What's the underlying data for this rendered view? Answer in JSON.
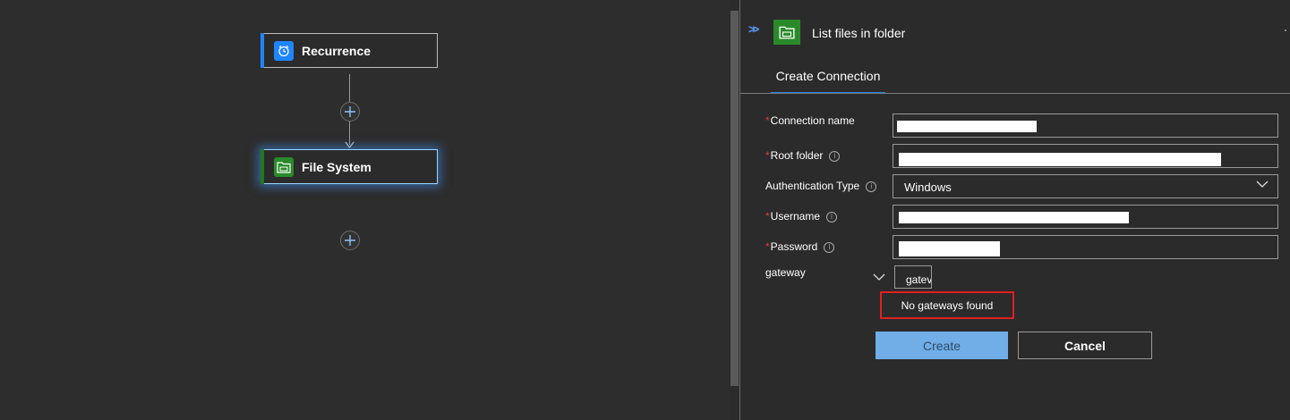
{
  "designer": {
    "nodes": [
      {
        "label": "Recurrence",
        "icon": "alarm-clock-icon",
        "accent": "#1f85ff"
      },
      {
        "label": "File System",
        "icon": "folder-icon",
        "accent": "#1f7a1f"
      }
    ]
  },
  "panel": {
    "title": "List files in folder",
    "title_icon": "folder-icon",
    "tab_label": "Create Connection",
    "fields": {
      "connection_name": {
        "label": "Connection name",
        "required": "*",
        "value": ""
      },
      "root_folder": {
        "label": "Root folder",
        "required": "*",
        "value": ""
      },
      "auth_type": {
        "label": "Authentication Type",
        "value": "Windows"
      },
      "username": {
        "label": "Username",
        "required": "*",
        "value": ""
      },
      "password": {
        "label": "Password",
        "required": "*",
        "value": ""
      },
      "gateway": {
        "label": "gateway",
        "value": "gatev"
      }
    },
    "dropdown_message": "No gateways found",
    "create_label": "Create",
    "cancel_label": "Cancel",
    "colors": {
      "required": "#e23b3b",
      "highlight_border": "#e02020",
      "create_button": "#71aee7",
      "tab_underline": "#2e7fd9"
    }
  }
}
